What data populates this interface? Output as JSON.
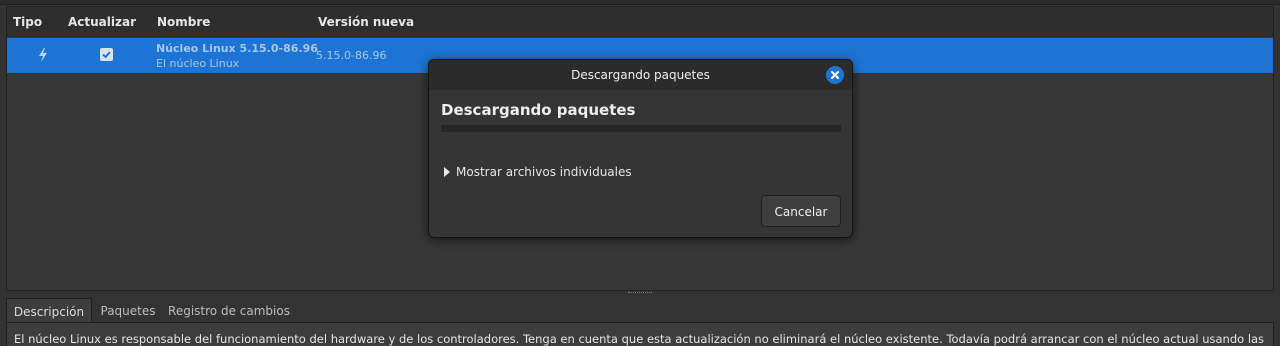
{
  "table": {
    "headers": {
      "type": "Tipo",
      "update": "Actualizar",
      "name": "Nombre",
      "new_version": "Versión nueva"
    },
    "rows": [
      {
        "type_icon": "lightning-icon",
        "update_checked": true,
        "name": "Núcleo Linux 5.15.0-86.96",
        "description": "El núcleo Linux",
        "new_version": "5.15.0-86.96"
      }
    ]
  },
  "tabs": [
    "Descripción",
    "Paquetes",
    "Registro de cambios"
  ],
  "description_text": "El núcleo Linux es responsable del funcionamiento del hardware y de los controladores. Tenga en cuenta que esta actualización no eliminará el núcleo existente. Todavía podrá arrancar con el núcleo actual usando las",
  "dialog": {
    "title": "Descargando paquetes",
    "heading": "Descargando paquetes",
    "progress": 0,
    "expander_label": "Mostrar archivos individuales",
    "cancel_label": "Cancelar"
  },
  "colors": {
    "accent": "#1e74d4",
    "background": "#333333"
  }
}
